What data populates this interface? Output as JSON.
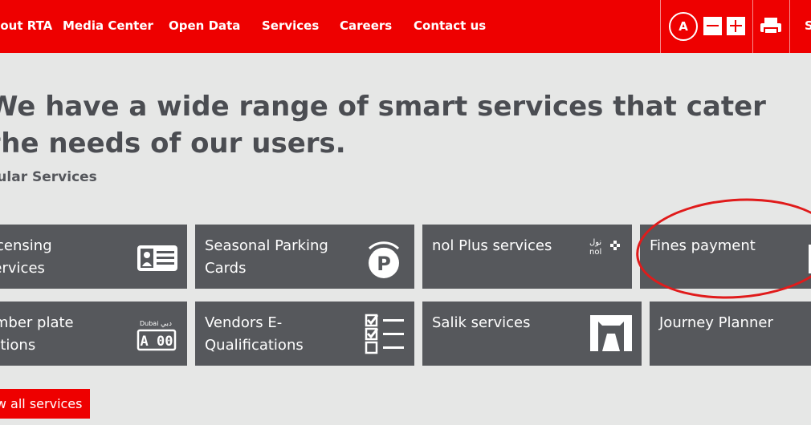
{
  "nav": {
    "items": [
      "About RTA",
      "Media Center",
      "Open Data",
      "Services",
      "Careers",
      "Contact us"
    ],
    "a_label": "A",
    "search_partial": "S"
  },
  "main": {
    "headline": "We have a wide range of smart services that cater the needs of our users.",
    "subhead": "Popular Services",
    "view_all": "View all services"
  },
  "tiles": [
    "Licensing Services",
    "Seasonal Parking Cards",
    "nol Plus services",
    "Fines payment",
    "Number plate auctions",
    "Vendors E-Qualifications",
    "Salik services",
    "Journey Planner"
  ],
  "icons": {
    "plate_small": "Dubai",
    "plate_arabic": "دبي",
    "plate_code": "A 00",
    "nol_arabic": "نول",
    "nol_latin": "nol",
    "parking_letter": "P"
  },
  "colors": {
    "brand_red": "#ee0000",
    "tile_grey": "#56585c",
    "bg": "#e6e7e6"
  }
}
